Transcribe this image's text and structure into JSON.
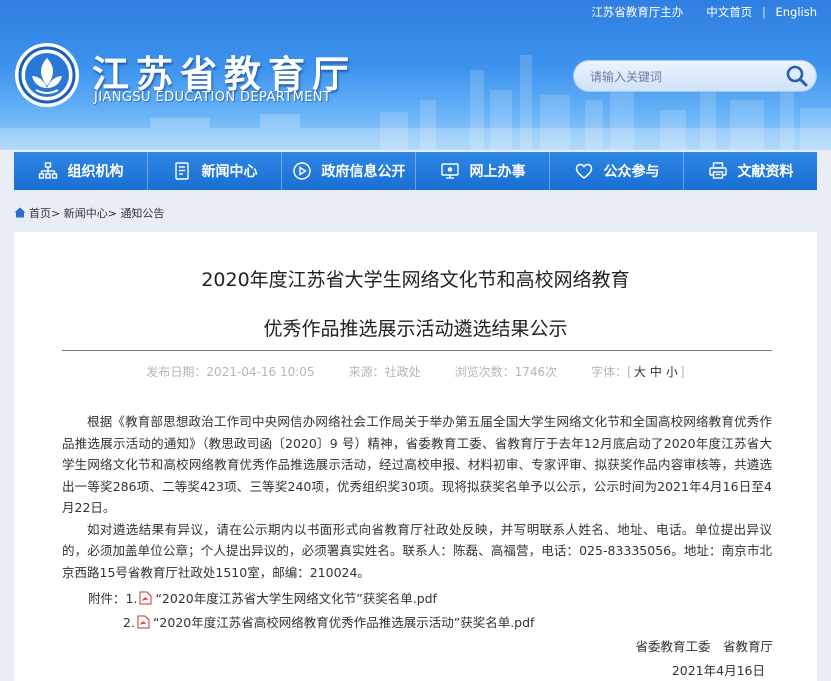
{
  "toplinks": {
    "sponsor": "江苏省教育厅主办",
    "home_cn": "中文首页",
    "separator": "|",
    "english": "English"
  },
  "site": {
    "name_cn": "江苏省教育厅",
    "name_en": "JIANGSU EDUCATION DEPARTMENT"
  },
  "search": {
    "placeholder": "请输入关键词"
  },
  "nav": [
    {
      "label": "组织机构",
      "icon": "org-chart-icon"
    },
    {
      "label": "新闻中心",
      "icon": "news-doc-icon"
    },
    {
      "label": "政府信息公开",
      "icon": "play-circle-icon"
    },
    {
      "label": "网上办事",
      "icon": "monitor-icon"
    },
    {
      "label": "公众参与",
      "icon": "heart-icon"
    },
    {
      "label": "文献资料",
      "icon": "printer-icon"
    }
  ],
  "breadcrumb": {
    "home": "首页",
    "sep": ">",
    "level1": "新闻中心",
    "level2": "通知公告"
  },
  "article": {
    "title_line1": "2020年度江苏省大学生网络文化节和高校网络教育",
    "title_line2": "优秀作品推选展示活动遴选结果公示",
    "meta": {
      "publish": "发布日期：2021-04-16 10:05",
      "source": "来源：社政处",
      "views": "浏览次数：1746次",
      "font_label": "字体：",
      "bracket_open": "[",
      "bracket_close": "]",
      "size_large": "大",
      "size_medium": "中",
      "size_small": "小"
    },
    "paragraphs": [
      "根据《教育部思想政治工作司中央网信办网络社会工作局关于举办第五届全国大学生网络文化节和全国高校网络教育优秀作品推选展示活动的通知》（教思政司函〔2020〕9 号）精神，省委教育工委、省教育厅于去年12月底启动了2020年度江苏省大学生网络文化节和高校网络教育优秀作品推选展示活动，经过高校申报、材料初审、专家评审、拟获奖作品内容审核等，共遴选出一等奖286项、二等奖423项、三等奖240项，优秀组织奖30项。现将拟获奖名单予以公示，公示时间为2021年4月16日至4月22日。",
      "如对遴选结果有异议，请在公示期内以书面形式向省教育厅社政处反映，并写明联系人姓名、地址、电话。单位提出异议的，必须加盖单位公章；个人提出异议的，必须署真实姓名。联系人：陈磊、高福营，电话：025-83335056。地址：南京市北京西路15号省教育厅社政处1510室，邮编：210024。"
    ],
    "attachments": {
      "label": "附件：",
      "items": [
        {
          "index": "1.",
          "name": "“2020年度江苏省大学生网络文化节”获奖名单.pdf"
        },
        {
          "index": "2.",
          "name": "“2020年度江苏省高校网络教育优秀作品推选展示活动”获奖名单.pdf"
        }
      ]
    },
    "signature": {
      "orgs": "省委教育工委　省教育厅",
      "date": "2021年4月16日"
    }
  }
}
